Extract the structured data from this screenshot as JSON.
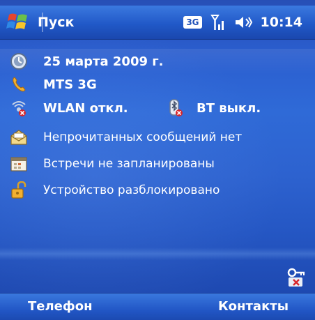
{
  "titlebar": {
    "title": "Пуск",
    "network_badge": "3G",
    "time": "10:14"
  },
  "today": {
    "date": "25 марта 2009 г.",
    "operator": "MTS 3G",
    "wlan_status": "WLAN откл.",
    "bt_status": "BT выкл.",
    "messages": "Непрочитанных сообщений нет",
    "appointments": "Встречи не запланированы",
    "device_lock": "Устройство разблокировано"
  },
  "softkeys": {
    "left": "Телефон",
    "right": "Контакты"
  },
  "icons": {
    "start": "windows-flag-icon",
    "signal": "signal-icon",
    "volume": "speaker-icon",
    "clock": "clock-icon",
    "phone": "phone-icon",
    "wlan": "wireless-icon",
    "bluetooth": "bluetooth-icon",
    "messages": "envelope-icon",
    "calendar": "calendar-icon",
    "lock": "padlock-icon",
    "tools": "key-tools-icon"
  },
  "colors": {
    "background": "#2b5fd0",
    "bar": "#2159c8",
    "text": "#ffffff",
    "off_mark": "#d8262c"
  }
}
